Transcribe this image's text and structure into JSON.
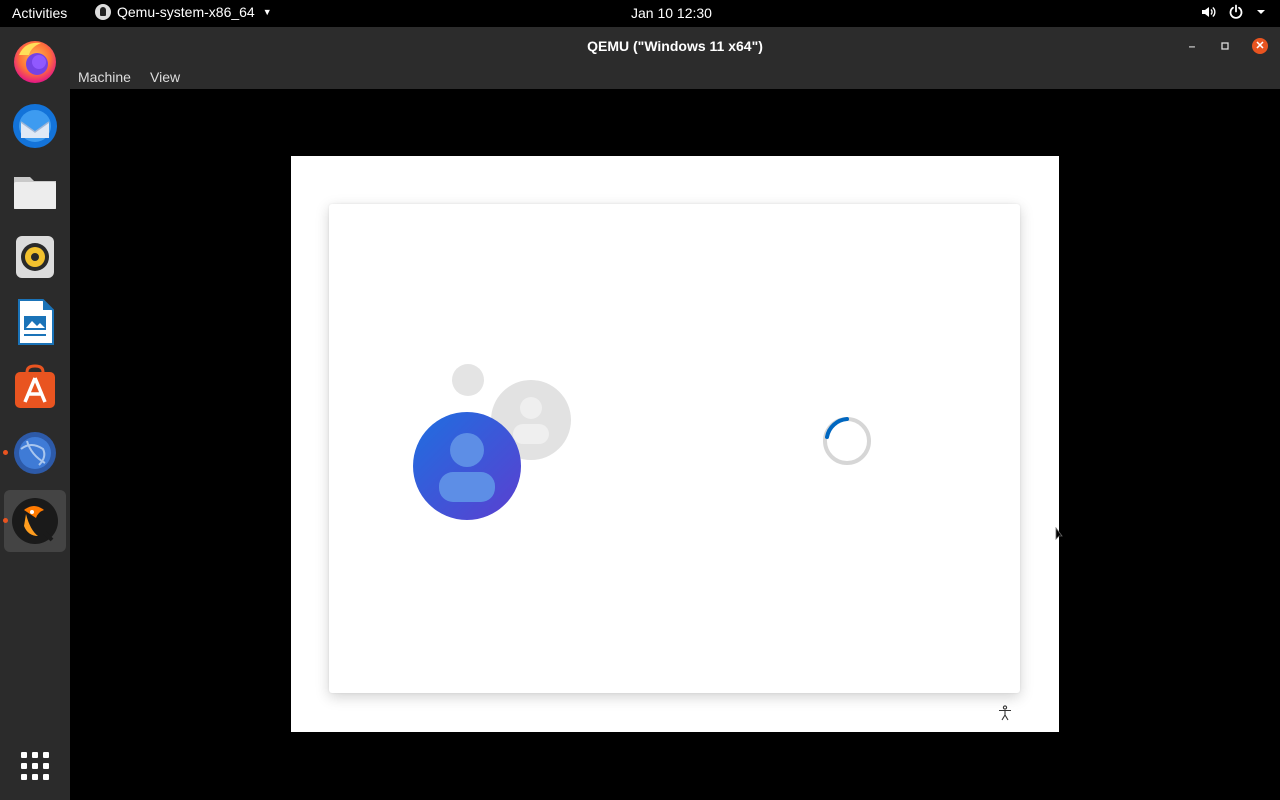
{
  "topbar": {
    "activities": "Activities",
    "app_name": "Qemu-system-x86_64",
    "clock": "Jan 10  12:30"
  },
  "dock": {
    "items": [
      {
        "name": "firefox"
      },
      {
        "name": "thunderbird"
      },
      {
        "name": "files"
      },
      {
        "name": "rhythmbox"
      },
      {
        "name": "libreoffice-writer"
      },
      {
        "name": "ubuntu-software"
      },
      {
        "name": "network-app"
      },
      {
        "name": "qemu"
      }
    ]
  },
  "window": {
    "title": "QEMU (\"Windows 11 x64\")",
    "menu": [
      "Machine",
      "View"
    ]
  },
  "colors": {
    "accent": "#e95420",
    "user_avatar": "#3b5bd6",
    "spinner": "#0067c0"
  }
}
